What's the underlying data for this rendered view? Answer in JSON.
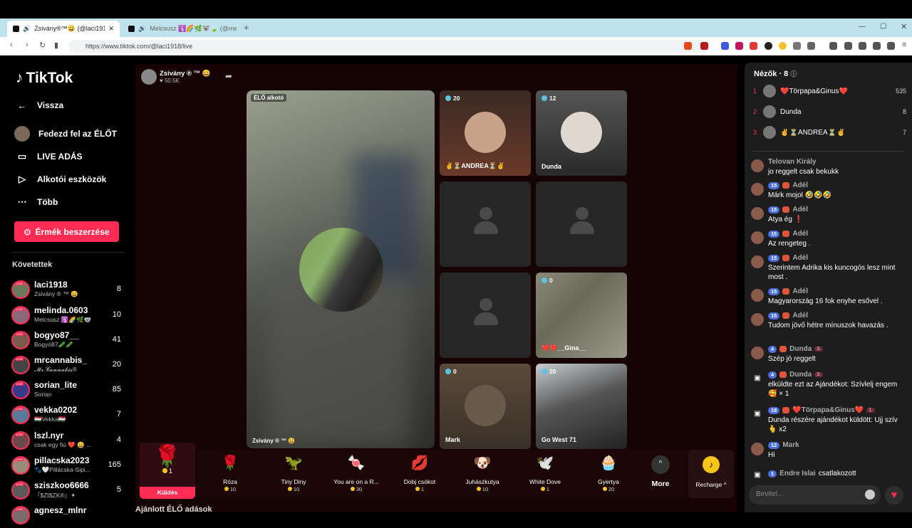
{
  "browser": {
    "tabs": [
      {
        "title": "Zsivány®™😀 (@laci1918) Él",
        "close": "✕"
      },
      {
        "title": "Melcsusz 🛐🌈🌿🐨🍃 (@me"
      }
    ],
    "new_tab": "+",
    "url": "https://www.tiktok.com/@laci1918/live"
  },
  "sidebar": {
    "logo": "TikTok",
    "nav": [
      {
        "label": "Vissza",
        "icon": "back-arrow-icon"
      },
      {
        "label": "Fedezd fel az ÉLŐT",
        "icon": "explore-avatar-icon"
      },
      {
        "label": "LIVE ADÁS",
        "icon": "video-camera-icon"
      },
      {
        "label": "Alkotói eszközök",
        "icon": "creator-tools-icon"
      },
      {
        "label": "Több",
        "icon": "more-dots-icon"
      }
    ],
    "coins_button": "Érmék beszerzése",
    "following_title": "Követettek",
    "following": [
      {
        "name": "laci1918",
        "sub": "Zsivány ® ™ 😀",
        "count": "8"
      },
      {
        "name": "melinda.0603",
        "sub": "Melcsusz 🛐🌈🌿🐨",
        "count": "10"
      },
      {
        "name": "bogyo87__",
        "sub": "Bogyó87🥒🥒",
        "count": "41"
      },
      {
        "name": "mrcannabis_",
        "sub": "𝓜𝓻.𝓒𝓪𝓷𝓷𝓪𝓫𝓲𝓼®",
        "count": "20"
      },
      {
        "name": "sorian_lite",
        "sub": "Sorian",
        "count": "85"
      },
      {
        "name": "vekka0202",
        "sub": "🇭🇺Vekka🇭🇺",
        "count": "7"
      },
      {
        "name": "lszl.nyr",
        "sub": "csak egy fiú ❤️ 😀 ...",
        "count": "4"
      },
      {
        "name": "pillacska2023",
        "sub": "🐾🤍Pillácska-Sipi...",
        "count": "165"
      },
      {
        "name": "sziszkoo6666",
        "sub": "『$ZI$ZK®』✦",
        "count": "5"
      },
      {
        "name": "agnesz_mlnr",
        "sub": "",
        "count": ""
      }
    ]
  },
  "host": {
    "name": "Zsivány ® ™ 😀",
    "likes": "♥ 50.5K",
    "live_badge": "ÉLŐ alkotó",
    "tile_name": "Zsivány ® ™ 😀"
  },
  "guests": [
    {
      "viewers": "20",
      "label": "✌️⏳ANDREA⏳✌️"
    },
    {
      "viewers": "12",
      "label": "Dunda"
    },
    {
      "viewers": "",
      "label": ""
    },
    {
      "viewers": "",
      "label": ""
    },
    {
      "viewers": "",
      "label": ""
    },
    {
      "viewers": "0",
      "label": "❤️❤️__Gina__"
    },
    {
      "viewers": "0",
      "label": "Mark"
    },
    {
      "viewers": "20",
      "label": "Go West 71"
    }
  ],
  "gifts": {
    "selected": {
      "price": "1",
      "send": "Küldés"
    },
    "items": [
      {
        "name": "Róza",
        "price": "10",
        "icon": "🌹"
      },
      {
        "name": "Tiny Diny",
        "price": "10",
        "icon": "🦖"
      },
      {
        "name": "You are on a R...",
        "price": "30",
        "icon": "🍬"
      },
      {
        "name": "Dobj csókot",
        "price": "1",
        "icon": "💋"
      },
      {
        "name": "Juhászkutya",
        "price": "10",
        "icon": "🐶"
      },
      {
        "name": "White Dove",
        "price": "1",
        "icon": "🕊️"
      },
      {
        "name": "Gyertya",
        "price": "20",
        "icon": "🧁"
      }
    ],
    "more": "More",
    "recharge": "Recharge ^"
  },
  "bottom_heading": "Ajánlott ÉLŐ adások",
  "chat": {
    "viewers_title": "Nézők · 8",
    "top_viewers": [
      {
        "rank": "1",
        "name": "❤️Törpapa&Ginus❤️",
        "score": "535"
      },
      {
        "rank": "2",
        "name": "Dunda",
        "score": "8"
      },
      {
        "rank": "3",
        "name": "✌️⏳ANDREA⏳✌️",
        "score": "7"
      }
    ],
    "messages": [
      {
        "user": "Telovan Király",
        "level": "",
        "text": "jo reggelt csak bekukk"
      },
      {
        "user": "Adél",
        "level": "15",
        "text": "Márk mojol 🤣🤣🤣"
      },
      {
        "user": "Adél",
        "level": "15",
        "text": "Atya ég ❗"
      },
      {
        "user": "Adél",
        "level": "15",
        "text": "Az rengeteg ."
      },
      {
        "user": "Adél",
        "level": "15",
        "text": "Szerintem Adrika kis kuncogós lesz mint most ."
      },
      {
        "user": "Adél",
        "level": "15",
        "text": "Magyarország 16 fok enyhe esővel ."
      },
      {
        "user": "Adél",
        "level": "15",
        "text": "Tudom jövő hétre mínuszok havazás ."
      },
      {
        "user": "Dunda",
        "level": "4",
        "rank": "3.",
        "text": "Szép jó reggelt"
      },
      {
        "user": "Dunda",
        "level": "4",
        "rank": "3.",
        "text": "elküldte ezt az Ajándékot: Szívlelj engem 🥰 × 1"
      },
      {
        "user": "❤️Törpapa&Ginus❤️",
        "level": "18",
        "rank": "1.",
        "text": "Dunda részére ajándékot küldött: Ujj szív 🫰 x2"
      },
      {
        "user": "Mark",
        "level": "12",
        "text": "Hi"
      },
      {
        "user": "Endre Islai",
        "level": "1",
        "text": "csatlakozott"
      }
    ],
    "input_placeholder": "Bevitel..."
  }
}
